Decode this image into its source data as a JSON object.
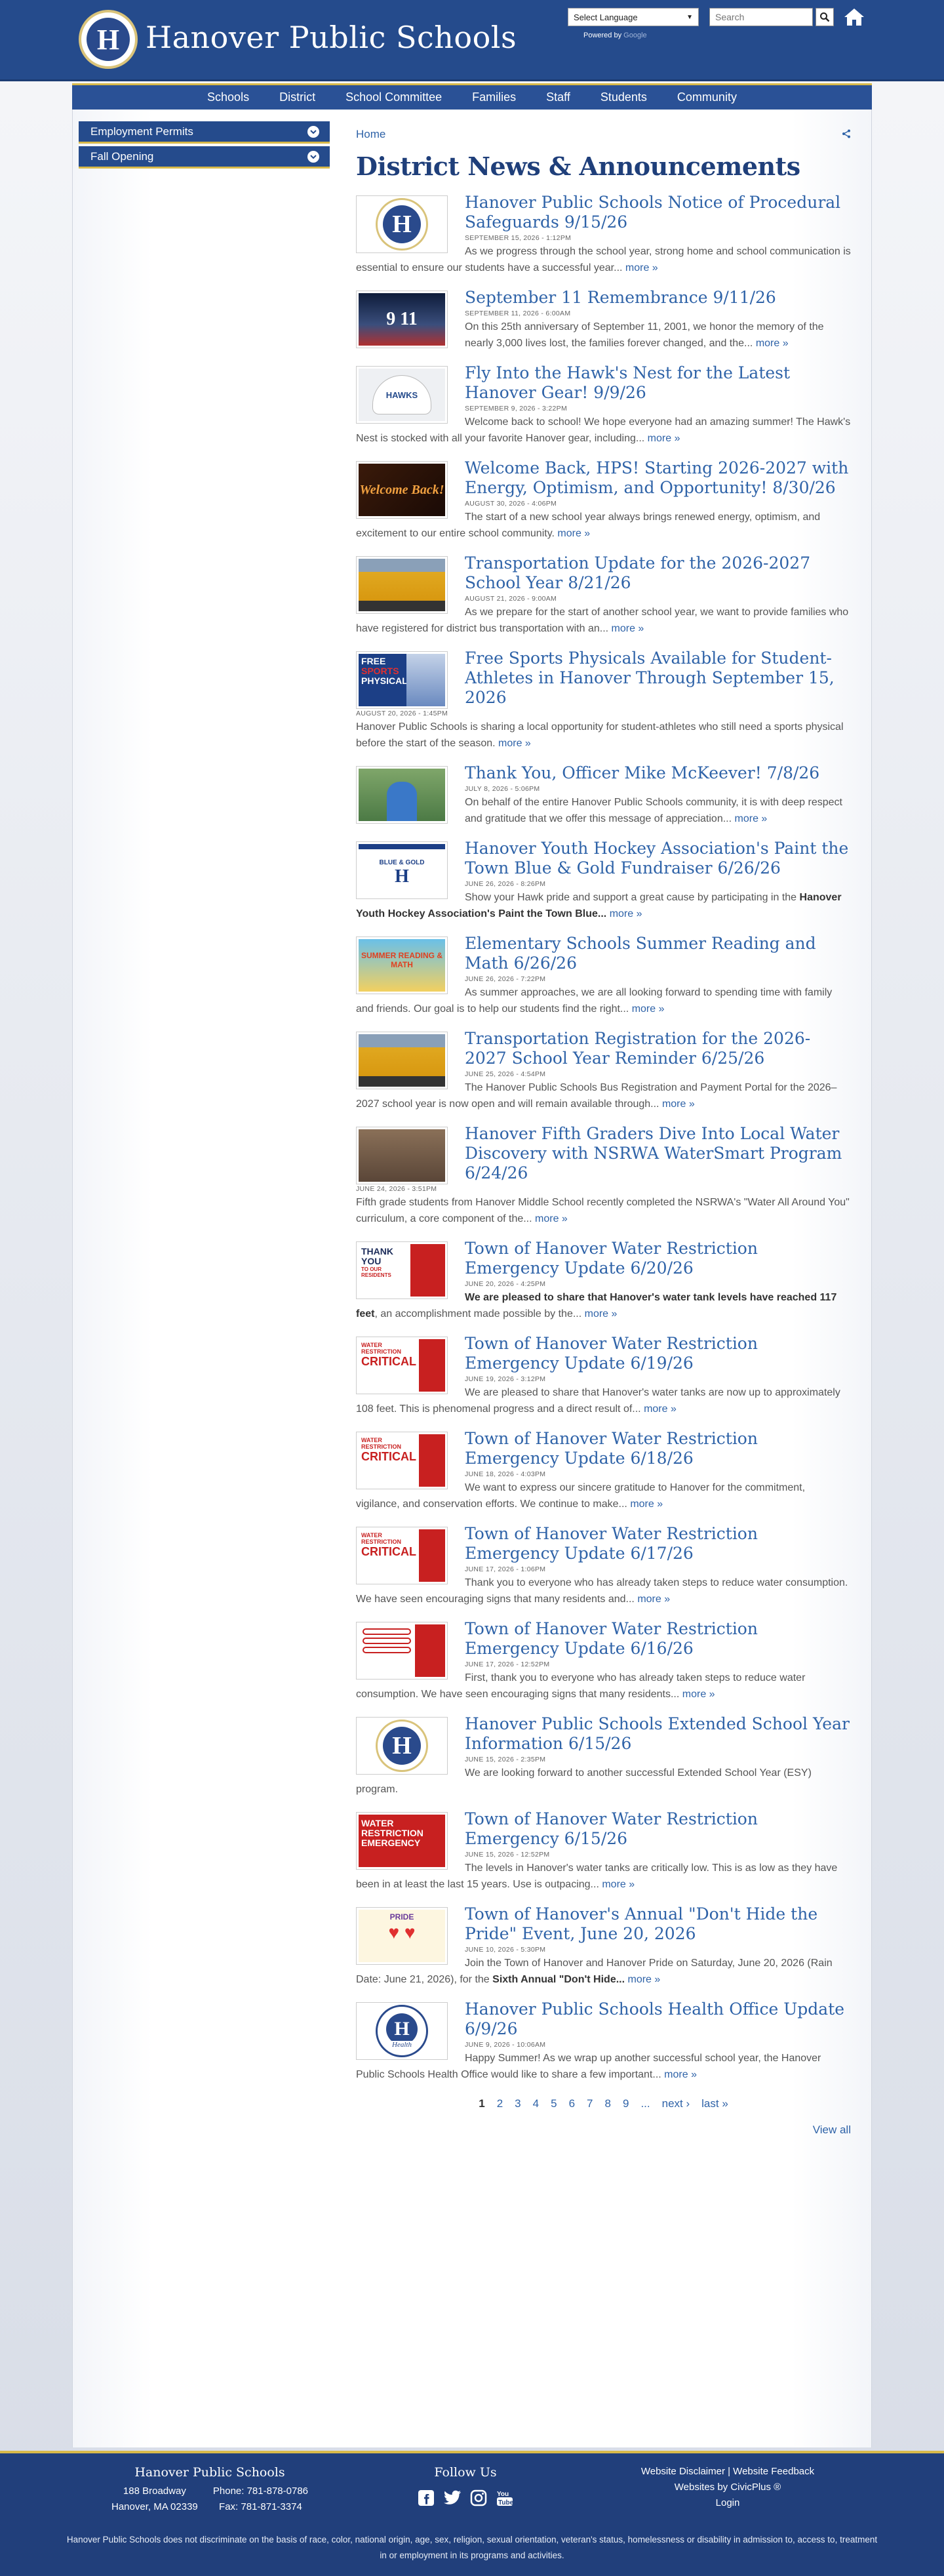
{
  "header": {
    "site_title": "Hanover Public Schools",
    "logo_letter": "H",
    "language_label": "Select Language",
    "powered_by": "Powered by",
    "powered_brand": "Google",
    "search_placeholder": "Search"
  },
  "nav": [
    "Schools",
    "District",
    "School Committee",
    "Families",
    "Staff",
    "Students",
    "Community"
  ],
  "sidebar": [
    {
      "label": "Employment Permits"
    },
    {
      "label": "Fall Opening"
    }
  ],
  "main": {
    "breadcrumb": "Home",
    "title": "District News & Announcements",
    "more_label": "more »",
    "items": [
      {
        "title": "Hanover Public Schools Notice of Procedural Safeguards 9/15/26",
        "date": "SEPTEMBER 15, 2026 - 1:12PM",
        "summary": "As we progress through the school year, strong home and school communication is essential to ensure our students have a successful year...",
        "thumb": "logo"
      },
      {
        "title": "September 11 Remembrance 9/11/26",
        "date": "SEPTEMBER 11, 2026 - 6:00AM",
        "summary": "On this 25th anniversary of September 11, 2001, we honor the memory of the nearly 3,000 lives lost, the families forever changed, and the...",
        "thumb": "911",
        "thumb_text": "9 11"
      },
      {
        "title": "Fly Into the Hawk's Nest for the Latest Hanover Gear! 9/9/26",
        "date": "SEPTEMBER 9, 2026 - 3:22PM",
        "summary": "Welcome back to school! We hope everyone had an amazing summer! The Hawk's Nest is stocked with all your favorite Hanover gear, including...",
        "thumb": "hat",
        "thumb_text": "HAWKS"
      },
      {
        "title": "Welcome Back, HPS! Starting 2026-2027 with Energy, Optimism, and Opportunity! 8/30/26",
        "date": "AUGUST 30, 2026 - 4:06PM",
        "summary": "The start of a new school year always brings renewed energy, optimism, and excitement to our entire school community.",
        "thumb": "welcome",
        "thumb_text": "Welcome Back!"
      },
      {
        "title": "Transportation Update for the 2026-2027 School Year 8/21/26",
        "date": "AUGUST 21, 2026 - 9:00AM",
        "summary": "As we prepare for the start of another school year, we want to provide families who have registered for district bus transportation with an...",
        "thumb": "bus"
      },
      {
        "title": "Free Sports Physicals Available for Student-Athletes in Hanover Through September 15, 2026",
        "date": "AUGUST 20, 2026 - 1:45PM",
        "summary": "Hanover Public Schools is sharing a local opportunity for student-athletes who still need a sports physical before the start of the season.",
        "thumb": "sports",
        "thumb_text": "FREE SPORTS PHYSICALS"
      },
      {
        "title": "Thank You, Officer Mike McKeever! 7/8/26",
        "date": "JULY 8, 2026 - 5:06PM",
        "summary": "On behalf of the entire Hanover Public Schools community, it is with deep respect and gratitude that we offer this message of appreciation...",
        "thumb": "officer"
      },
      {
        "title": "Hanover Youth Hockey Association's Paint the Town Blue & Gold Fundraiser 6/26/26",
        "date": "JUNE 26, 2026 - 8:26PM",
        "summary_pre": "Show your Hawk pride and support a great cause by participating in the ",
        "summary_bold": "Hanover Youth Hockey Association's Paint the Town Blue...",
        "thumb": "hockey",
        "thumb_text": "BLUE & GOLD"
      },
      {
        "title": "Elementary Schools Summer Reading and Math 6/26/26",
        "date": "JUNE 26, 2026 - 7:22PM",
        "summary": "As summer approaches, we are all looking forward to spending time with family and friends. Our goal is to help our students find the right...",
        "thumb": "summer",
        "thumb_text": "SUMMER READING & MATH"
      },
      {
        "title": "Transportation Registration for the 2026-2027 School Year Reminder 6/25/26",
        "date": "JUNE 25, 2026 - 4:54PM",
        "summary": "The Hanover Public Schools Bus Registration and Payment Portal for the 2026–2027 school year is now open and will remain available through...",
        "thumb": "bus2"
      },
      {
        "title": "Hanover Fifth Graders Dive Into Local Water Discovery with NSRWA WaterSmart Program 6/24/26",
        "date": "JUNE 24, 2026 - 3:51PM",
        "summary": "Fifth grade students from Hanover Middle School recently completed the NSRWA's \"Water All Around You\" curriculum, a core component of the...",
        "thumb": "fifth"
      },
      {
        "title": "Town of Hanover Water Restriction Emergency Update 6/20/26",
        "date": "JUNE 20, 2026 - 4:25PM",
        "summary_bold": "We are pleased to share that Hanover's water tank levels have reached 117 feet",
        "summary_post": ", an accomplishment made possible by the...",
        "thumb": "thankyou",
        "thumb_text": "THANK YOU"
      },
      {
        "title": "Town of Hanover Water Restriction Emergency Update 6/19/26",
        "date": "JUNE 19, 2026 - 3:12PM",
        "summary": "We are pleased to share that Hanover's water tanks are now up to approximately 108 feet. This is phenomenal progress and a direct result of...",
        "thumb": "critical",
        "thumb_text": "CRITICAL"
      },
      {
        "title": "Town of Hanover Water Restriction Emergency Update 6/18/26",
        "date": "JUNE 18, 2026 - 4:03PM",
        "summary": "We want to express our sincere gratitude to Hanover for the commitment, vigilance, and conservation efforts. We continue to make...",
        "thumb": "critical2",
        "thumb_text": "CRITICAL"
      },
      {
        "title": "Town of Hanover Water Restriction Emergency Update 6/17/26",
        "date": "JUNE 17, 2026 - 1:06PM",
        "summary": "Thank you to everyone who has already taken steps to reduce water consumption. We have seen encouraging signs that many residents and...",
        "thumb": "supply",
        "thumb_text": "CRITICAL"
      },
      {
        "title": "Town of Hanover Water Restriction Emergency Update 6/16/26",
        "date": "JUNE 17, 2026 - 12:52PM",
        "summary": "First, thank you to everyone who has already taken steps to reduce water consumption. We have seen encouraging signs that many residents...",
        "thumb": "signs"
      },
      {
        "title": "Hanover Public Schools Extended School Year Information 6/15/26",
        "date": "JUNE 15, 2026 - 2:35PM",
        "summary": "We are looking forward to another successful Extended School Year (ESY) program.",
        "thumb": "logo",
        "nomore": true
      },
      {
        "title": "Town of Hanover Water Restriction Emergency 6/15/26",
        "date": "JUNE 15, 2026 - 12:52PM",
        "summary": "The levels in Hanover's water tanks are critically low. This is as low as they have been in at least the last 15 years. Use is outpacing...",
        "thumb": "emergency",
        "thumb_text": "WATER RESTRICTION EMERGENCY"
      },
      {
        "title": "Town of Hanover's Annual \"Don't Hide the Pride\" Event, June 20, 2026",
        "date": "JUNE 10, 2026 - 5:30PM",
        "summary_pre": "Join the Town of Hanover and Hanover Pride on Saturday, June 20, 2026 (Rain Date: June 21, 2026), for the ",
        "summary_bold": "Sixth Annual \"Don't Hide...",
        "thumb": "pride",
        "thumb_text": "PRIDE"
      },
      {
        "title": "Hanover Public Schools Health Office Update 6/9/26",
        "date": "JUNE 9, 2026 - 10:06AM",
        "summary": "Happy Summer! As we wrap up another successful school year, the Hanover Public Schools Health Office would like to share a few important...",
        "thumb": "health",
        "thumb_text": "Health"
      }
    ]
  },
  "pager": {
    "pages": [
      "1",
      "2",
      "3",
      "4",
      "5",
      "6",
      "7",
      "8",
      "9",
      "..."
    ],
    "next": "next ›",
    "last": "last »",
    "view_all": "View all"
  },
  "footer": {
    "name": "Hanover Public Schools",
    "address1": "188 Broadway",
    "address2": "Hanover, MA 02339",
    "phone": "Phone: 781-878-0786",
    "fax": "Fax: 781-871-3374",
    "follow": "Follow Us",
    "links1": "Website Disclaimer | Website Feedback",
    "links2": "Websites by CivicPlus ®",
    "login": "Login",
    "disclaimer": "Hanover Public Schools does not discriminate on the basis of race, color, national origin, age, sex, religion, sexual orientation, veteran's status, homelessness or disability in admission to, access to, treatment in or employment in its programs and activities."
  }
}
